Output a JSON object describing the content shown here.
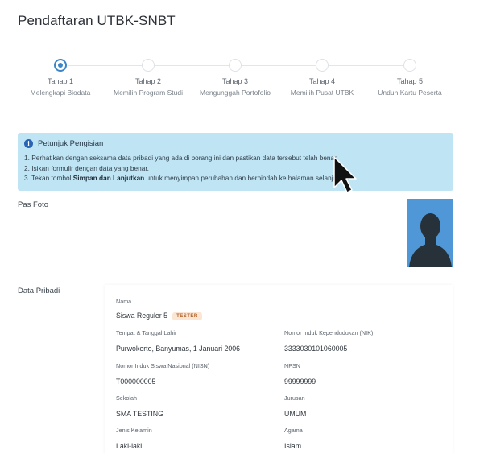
{
  "page": {
    "title": "Pendaftaran UTBK-SNBT"
  },
  "stepper": {
    "steps": [
      {
        "title": "Tahap 1",
        "subtitle": "Melengkapi Biodata",
        "active": true
      },
      {
        "title": "Tahap 2",
        "subtitle": "Memilih Program Studi",
        "active": false
      },
      {
        "title": "Tahap 3",
        "subtitle": "Mengunggah Portofolio",
        "active": false
      },
      {
        "title": "Tahap 4",
        "subtitle": "Memilih Pusat UTBK",
        "active": false
      },
      {
        "title": "Tahap 5",
        "subtitle": "Unduh Kartu Peserta",
        "active": false
      }
    ]
  },
  "info": {
    "title": "Petunjuk Pengisian",
    "icon": "info-icon",
    "item1": "1. Perhatikan dengan seksama data pribadi yang ada di borang ini dan pastikan data tersebut telah benar.",
    "item2": "2. Isikan formulir dengan data yang benar.",
    "item3_pre": "3. Tekan tombol ",
    "item3_bold": "Simpan dan Lanjutkan",
    "item3_post": " untuk menyimpan perubahan dan berpindah ke halaman selanjutnya."
  },
  "pas_foto": {
    "label": "Pas Foto"
  },
  "data_pribadi": {
    "label": "Data Pribadi",
    "nama": {
      "label": "Nama",
      "value": "Siswa Reguler 5",
      "badge": "TESTER"
    },
    "ttl": {
      "label": "Tempat & Tanggal Lahir",
      "value": "Purwokerto, Banyumas, 1 Januari 2006"
    },
    "nik": {
      "label": "Nomor Induk Kependudukan (NIK)",
      "value": "3333030101060005"
    },
    "nisn": {
      "label": "Nomor Induk Siswa Nasional (NISN)",
      "value": "T000000005"
    },
    "npsn": {
      "label": "NPSN",
      "value": "99999999"
    },
    "sekolah": {
      "label": "Sekolah",
      "value": "SMA TESTING"
    },
    "jurusan": {
      "label": "Jurusan",
      "value": "UMUM"
    },
    "jenis_kelamin": {
      "label": "Jenis Kelamin",
      "value": "Laki-laki"
    },
    "agama": {
      "label": "Agama",
      "value": "Islam"
    }
  },
  "colors": {
    "accent": "#3b86c8",
    "info_bg": "#bfe4f3",
    "photo_bg": "#4f97d6",
    "badge_bg": "#fbe6d3"
  }
}
